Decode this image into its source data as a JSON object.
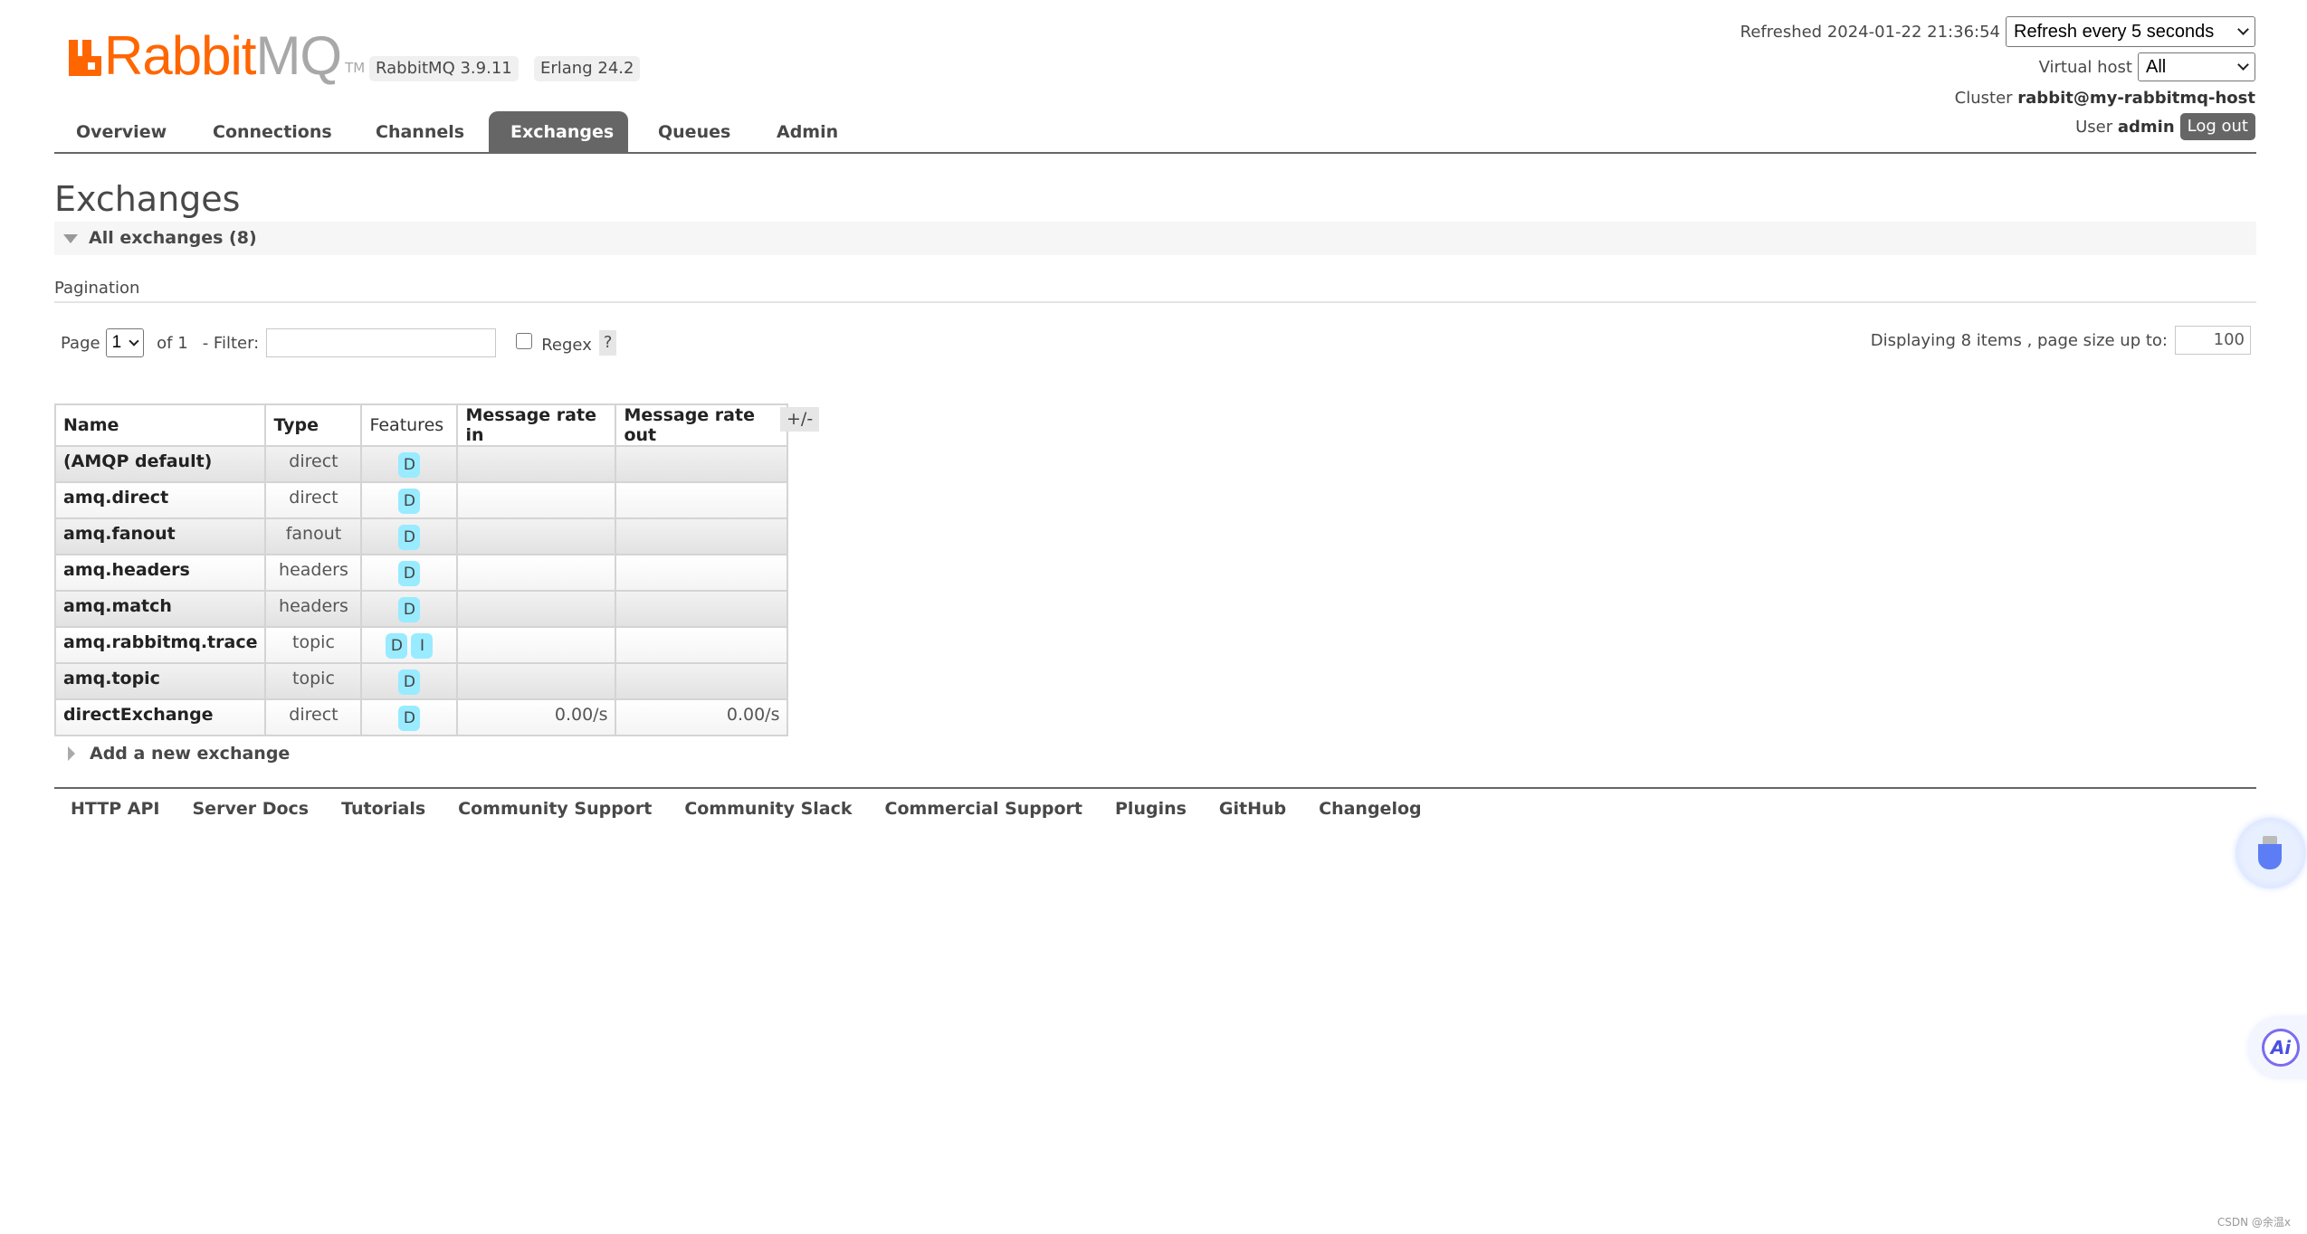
{
  "header": {
    "logo_primary": "Rabbit",
    "logo_secondary": "MQ",
    "logo_tm": "TM",
    "version_badge": "RabbitMQ 3.9.11",
    "erlang_badge": "Erlang 24.2",
    "refreshed_label": "Refreshed 2024-01-22 21:36:54",
    "refresh_select": "Refresh every 5 seconds",
    "vhost_label": "Virtual host",
    "vhost_select": "All",
    "cluster_label": "Cluster",
    "cluster_name": "rabbit@my-rabbitmq-host",
    "user_label": "User",
    "user_name": "admin",
    "logout_label": "Log out"
  },
  "nav": {
    "tabs": [
      {
        "label": "Overview"
      },
      {
        "label": "Connections"
      },
      {
        "label": "Channels"
      },
      {
        "label": "Exchanges",
        "active": true
      },
      {
        "label": "Queues"
      },
      {
        "label": "Admin"
      }
    ]
  },
  "main": {
    "title": "Exchanges",
    "section_label": "All exchanges (8)",
    "pagination_label": "Pagination",
    "page_label": "Page",
    "page_value": "1",
    "of_label": "of 1",
    "filter_label": "- Filter:",
    "filter_value": "",
    "regex_label": "Regex",
    "regex_checked": false,
    "help_label": "?",
    "display_label": "Displaying 8 items , page size up to:",
    "page_size": "100",
    "columns_toggle": "+/-",
    "table": {
      "headers": [
        "Name",
        "Type",
        "Features",
        "Message rate in",
        "Message rate out"
      ],
      "rows": [
        {
          "name": "(AMQP default)",
          "type": "direct",
          "features": [
            "D"
          ],
          "rate_in": "",
          "rate_out": ""
        },
        {
          "name": "amq.direct",
          "type": "direct",
          "features": [
            "D"
          ],
          "rate_in": "",
          "rate_out": ""
        },
        {
          "name": "amq.fanout",
          "type": "fanout",
          "features": [
            "D"
          ],
          "rate_in": "",
          "rate_out": ""
        },
        {
          "name": "amq.headers",
          "type": "headers",
          "features": [
            "D"
          ],
          "rate_in": "",
          "rate_out": ""
        },
        {
          "name": "amq.match",
          "type": "headers",
          "features": [
            "D"
          ],
          "rate_in": "",
          "rate_out": ""
        },
        {
          "name": "amq.rabbitmq.trace",
          "type": "topic",
          "features": [
            "D",
            "I"
          ],
          "rate_in": "",
          "rate_out": ""
        },
        {
          "name": "amq.topic",
          "type": "topic",
          "features": [
            "D"
          ],
          "rate_in": "",
          "rate_out": ""
        },
        {
          "name": "directExchange",
          "type": "direct",
          "features": [
            "D"
          ],
          "rate_in": "0.00/s",
          "rate_out": "0.00/s"
        }
      ]
    },
    "add_exchange_label": "Add a new exchange"
  },
  "footer": {
    "links": [
      "HTTP API",
      "Server Docs",
      "Tutorials",
      "Community Support",
      "Community Slack",
      "Commercial Support",
      "Plugins",
      "GitHub",
      "Changelog"
    ]
  },
  "overlay": {
    "ai_label": "Ai",
    "watermark": "CSDN @余温x"
  },
  "colors": {
    "brand_orange": "#ff6600",
    "active_tab": "#666666",
    "feature_badge": "#99ebff"
  }
}
